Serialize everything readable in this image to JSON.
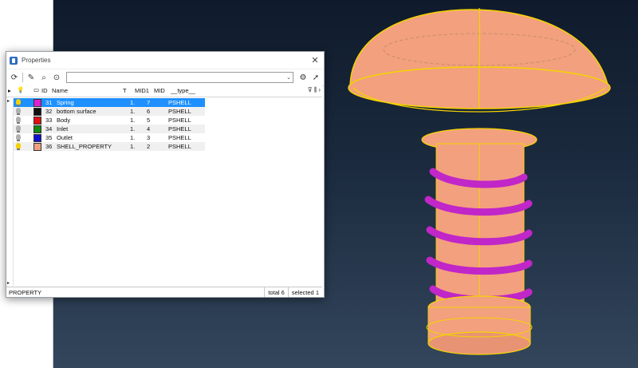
{
  "window": {
    "title": "Properties",
    "close_glyph": "✕"
  },
  "toolbar": {
    "icons": [
      "refresh-icon",
      "pin-icon",
      "find-icon",
      "search-icon",
      "settings-icon",
      "cursor-icon"
    ],
    "search_value": ""
  },
  "table": {
    "columns": [
      "Name",
      "T",
      "MID1",
      "MID",
      "__type__"
    ],
    "rows": [
      {
        "id": "31",
        "name": "Spring",
        "t": "1.",
        "mid1": "7",
        "mid": "PSHELL",
        "color": "#e020d0",
        "bulb": "#f5d000",
        "selected": true
      },
      {
        "id": "32",
        "name": "bottom surface",
        "t": "1.",
        "mid1": "6",
        "mid": "PSHELL",
        "color": "#111111",
        "bulb": "#b0b0b0",
        "selected": false
      },
      {
        "id": "33",
        "name": "Body",
        "t": "1.",
        "mid1": "5",
        "mid": "PSHELL",
        "color": "#e01010",
        "bulb": "#b0b0b0",
        "selected": false
      },
      {
        "id": "34",
        "name": "Inlet",
        "t": "1.",
        "mid1": "4",
        "mid": "PSHELL",
        "color": "#108a10",
        "bulb": "#b0b0b0",
        "selected": false
      },
      {
        "id": "35",
        "name": "Outlet",
        "t": "1.",
        "mid1": "3",
        "mid": "PSHELL",
        "color": "#1010d0",
        "bulb": "#b0b0b0",
        "selected": false
      },
      {
        "id": "36",
        "name": "SHELL_PROPERTY",
        "t": "1.",
        "mid1": "2",
        "mid": "PSHELL",
        "color": "#f0a080",
        "bulb": "#f5d000",
        "selected": false
      }
    ]
  },
  "status": {
    "entity": "PROPERTY",
    "total": "total 6",
    "selected": "selected 1"
  },
  "colors": {
    "selection": "#1e90ff",
    "model_body": "#f2a07e",
    "spring": "#c026c8",
    "outline": "#f5d400"
  }
}
